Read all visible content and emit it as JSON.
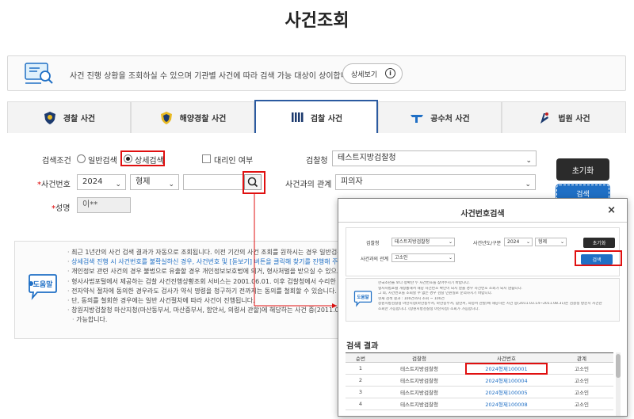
{
  "page_title": "사건조회",
  "notice": {
    "text": "사건 진행 상황을 조회하실 수 있으며 기관별 사건에 따라 검색 가능 대상이 상이합니다.",
    "detail_button": "상세보기"
  },
  "tabs": [
    {
      "label": "경찰 사건",
      "icon": "police-badge-icon",
      "active": false
    },
    {
      "label": "해양경찰 사건",
      "icon": "coast-guard-badge-icon",
      "active": false
    },
    {
      "label": "검찰 사건",
      "icon": "prosecution-icon",
      "active": true
    },
    {
      "label": "공수처 사건",
      "icon": "cio-icon",
      "active": false
    },
    {
      "label": "법원 사건",
      "icon": "court-icon",
      "active": false
    }
  ],
  "form": {
    "condition_label": "검색조건",
    "radio_simple": "일반검색",
    "radio_detail": "상세검색",
    "proxy_label": "대리인 여부",
    "office_label": "검찰청",
    "office_value": "테스트지방검찰청",
    "case_no_label": "사건번호",
    "year_value": "2024",
    "type_value": "형제",
    "relation_label": "사건과의 관계",
    "relation_value": "피의자",
    "name_label": "성명",
    "name_value": "이**",
    "required_mark": "*",
    "reset_button": "초기화",
    "search_button": "검색"
  },
  "help": {
    "badge": "도움말",
    "items": [
      "최근 1년간의 사건 검색 결과가 자동으로 조회됩니다. 이전 기간의 사건 조회를 원하시는 경우 일반검색에서",
      "상세검색 진행 시 사건번호를 불확실하신 경우, 사건번호 및 [돋보기] 버튼을 클릭해 찾기를 진행해 주세요.",
      "개인정보 관련 사건의 경우 불법으로 유출할 경우 개인정보보호법에 의거, 형사처벌을 받으실 수 있으므로 유의하",
      "형사사법포털에서 제공하는 검찰 사건진행상황조회 서비스는 2001.06.01. 이후 검찰청에서 수리한 사건이",
      "전자약식 절차에 동의한 경우라도 검사가 약식 명령을 청구하기 전까지는 동의를 철회할 수 있습니다. (전자",
      "단, 동의를 철회한 경우에는 일반 사건절차에 따라 사건이 진행됩니다.",
      "창원지방검찰청 마산지청(마산동부서, 마산중부서, 함안서, 의령서 관할)에 해당하는 사건 중(2011.03.14",
      "가능합니다."
    ]
  },
  "popup": {
    "title": "사건번호검색",
    "close": "×",
    "office_label": "검찰청",
    "office_value": "테스트지방검찰청",
    "year_type_label": "사건년도/구분",
    "year_value": "2024",
    "type_value": "형제",
    "relation_label": "사건과의 관계",
    "relation_value": "고소인",
    "reset_button": "초기화",
    "search_button": "검색",
    "help_items": [
      "한국소년을 보다 정확한 두 사건번호를 찾아주시기 바랍니다.",
      "형사사법포털 개정통해서 해당 사건번호 확인이 되지 않을 경우 사건번호 조회가 되지 않습니다.",
      "그 외, 사건번호를 조회할 수 없는 경우 검찰 민원실로 문의하시기 바랍니다.",
      "현재 검색 결과 : 100건까지 조회 ~ 100건",
      "창원지방검찰청 마산지청(마산동부서, 마산중부서, 함안서, 의령서 관할)에 해당하는 사건 중(2011.03.14~2011.08.31)은 검찰청 방문시 사건관",
      "조회만 가능합니다. (창원지방검찰청 마산지청) 조회가 가능합니다."
    ],
    "results_title": "검색 결과",
    "columns": [
      "순번",
      "검찰청",
      "사건번호",
      "관계"
    ],
    "rows": [
      [
        "1",
        "테스트지방검찰청",
        "2024형제100001",
        "고소인"
      ],
      [
        "2",
        "테스트지방검찰청",
        "2024형제100004",
        "고소인"
      ],
      [
        "3",
        "테스트지방검찰청",
        "2024형제100005",
        "고소인"
      ],
      [
        "4",
        "테스트지방검찰청",
        "2024형제100008",
        "고소인"
      ]
    ]
  },
  "colors": {
    "accent_blue": "#1f6fc5",
    "tab_border": "#2b5aa0",
    "highlight_red": "#e01010",
    "dark_button": "#2b2b2b"
  }
}
